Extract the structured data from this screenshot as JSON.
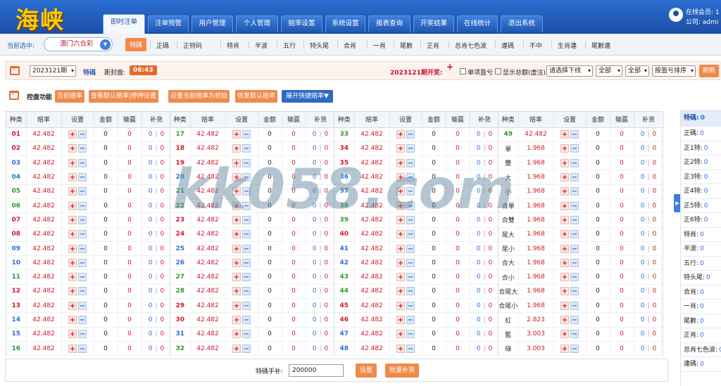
{
  "header": {
    "logo": "海峡",
    "tabs": [
      "即时注单",
      "注单预警",
      "用户管理",
      "个人管理",
      "赔率设置",
      "系统设置",
      "报表查询",
      "开奖结果",
      "在线统计",
      "退出系统"
    ],
    "active_tab": 0,
    "member_label": "在线会员: 1",
    "company_label": "公司: admi"
  },
  "subbar": {
    "current_label": "当前选中:",
    "lottery": "澳门六合彩",
    "tabs": [
      "特碼",
      "正碼",
      "正特码",
      "特肖",
      "半波",
      "五行",
      "特头尾",
      "合肖",
      "一肖",
      "尾數",
      "正肖",
      "总肖七色波",
      "連碼",
      "不中",
      "生肖連",
      "尾數連"
    ],
    "active_tab": 0
  },
  "info": {
    "period": "2023121期",
    "play": "特碼",
    "close_label": "距封盘:",
    "countdown": "06:43",
    "draw_label": "2023121期开奖:",
    "draw_value": "+",
    "cb_single": "单项盈亏",
    "cb_virtual": "显示总额(虚注)",
    "sel_1": "请选择下线",
    "sel_2": "全部",
    "sel_3": "全部",
    "sel_4": "按盈亏排序",
    "refresh": "刷新"
  },
  "controls": {
    "label": "控盘功能",
    "btn_current": "当前赔率",
    "btn_default": "查看默认赔率|停押设置",
    "btn_set_init": "设置当前赔率为初始",
    "btn_restore": "恢复默认赔率",
    "btn_expand": "展开快捷赔率▼"
  },
  "table": {
    "headers": [
      "种类",
      "赔率",
      "设置",
      "金额",
      "输赢",
      "补货"
    ],
    "cols": [
      [
        {
          "k": "01",
          "o": "42.482",
          "c": "red"
        },
        {
          "k": "02",
          "o": "42.482",
          "c": "red"
        },
        {
          "k": "03",
          "o": "42.482",
          "c": "blue"
        },
        {
          "k": "04",
          "o": "42.482",
          "c": "blue"
        },
        {
          "k": "05",
          "o": "42.482",
          "c": "green"
        },
        {
          "k": "06",
          "o": "42.482",
          "c": "green"
        },
        {
          "k": "07",
          "o": "42.482",
          "c": "red"
        },
        {
          "k": "08",
          "o": "42.482",
          "c": "red"
        },
        {
          "k": "09",
          "o": "42.482",
          "c": "blue"
        },
        {
          "k": "10",
          "o": "42.482",
          "c": "blue"
        },
        {
          "k": "11",
          "o": "42.482",
          "c": "green"
        },
        {
          "k": "12",
          "o": "42.482",
          "c": "red"
        },
        {
          "k": "13",
          "o": "42.482",
          "c": "red"
        },
        {
          "k": "14",
          "o": "42.482",
          "c": "blue"
        },
        {
          "k": "15",
          "o": "42.482",
          "c": "blue"
        },
        {
          "k": "16",
          "o": "42.482",
          "c": "green"
        }
      ],
      [
        {
          "k": "17",
          "o": "42.482",
          "c": "green"
        },
        {
          "k": "18",
          "o": "42.482",
          "c": "red"
        },
        {
          "k": "19",
          "o": "42.482",
          "c": "red"
        },
        {
          "k": "20",
          "o": "42.482",
          "c": "blue"
        },
        {
          "k": "21",
          "o": "42.482",
          "c": "green"
        },
        {
          "k": "22",
          "o": "42.482",
          "c": "green"
        },
        {
          "k": "23",
          "o": "42.482",
          "c": "red"
        },
        {
          "k": "24",
          "o": "42.482",
          "c": "red"
        },
        {
          "k": "25",
          "o": "42.482",
          "c": "blue"
        },
        {
          "k": "26",
          "o": "42.482",
          "c": "blue"
        },
        {
          "k": "27",
          "o": "42.482",
          "c": "green"
        },
        {
          "k": "28",
          "o": "42.482",
          "c": "green"
        },
        {
          "k": "29",
          "o": "42.482",
          "c": "red"
        },
        {
          "k": "30",
          "o": "42.482",
          "c": "red"
        },
        {
          "k": "31",
          "o": "42.482",
          "c": "blue"
        },
        {
          "k": "32",
          "o": "42.482",
          "c": "green"
        }
      ],
      [
        {
          "k": "33",
          "o": "42.482",
          "c": "green"
        },
        {
          "k": "34",
          "o": "42.482",
          "c": "red"
        },
        {
          "k": "35",
          "o": "42.482",
          "c": "red"
        },
        {
          "k": "36",
          "o": "42.482",
          "c": "blue"
        },
        {
          "k": "37",
          "o": "42.482",
          "c": "blue"
        },
        {
          "k": "38",
          "o": "42.482",
          "c": "green"
        },
        {
          "k": "39",
          "o": "42.482",
          "c": "green"
        },
        {
          "k": "40",
          "o": "42.482",
          "c": "red"
        },
        {
          "k": "41",
          "o": "42.482",
          "c": "blue"
        },
        {
          "k": "42",
          "o": "42.482",
          "c": "blue"
        },
        {
          "k": "43",
          "o": "42.482",
          "c": "green"
        },
        {
          "k": "44",
          "o": "42.482",
          "c": "green"
        },
        {
          "k": "45",
          "o": "42.482",
          "c": "red"
        },
        {
          "k": "46",
          "o": "42.482",
          "c": "red"
        },
        {
          "k": "47",
          "o": "42.482",
          "c": "blue"
        },
        {
          "k": "48",
          "o": "42.482",
          "c": "blue"
        }
      ],
      [
        {
          "k": "49",
          "o": "42.482",
          "c": "green"
        },
        {
          "k": "單",
          "o": "1.968",
          "c": "txt"
        },
        {
          "k": "雙",
          "o": "1.968",
          "c": "txt"
        },
        {
          "k": "大",
          "o": "1.968",
          "c": "txt"
        },
        {
          "k": "小",
          "o": "1.968",
          "c": "txt"
        },
        {
          "k": "合單",
          "o": "1.968",
          "c": "txt"
        },
        {
          "k": "合雙",
          "o": "1.968",
          "c": "txt"
        },
        {
          "k": "尾大",
          "o": "1.968",
          "c": "txt"
        },
        {
          "k": "尾小",
          "o": "1.968",
          "c": "txt"
        },
        {
          "k": "合大",
          "o": "1.968",
          "c": "txt"
        },
        {
          "k": "合小",
          "o": "1.968",
          "c": "txt"
        },
        {
          "k": "合尾大",
          "o": "1.968",
          "c": "txt"
        },
        {
          "k": "合尾小",
          "o": "1.968",
          "c": "txt"
        },
        {
          "k": "紅",
          "o": "2.823",
          "c": "txt"
        },
        {
          "k": "藍",
          "o": "3.003",
          "c": "txt"
        },
        {
          "k": "綠",
          "o": "3.003",
          "c": "txt"
        }
      ]
    ],
    "amount": "0",
    "winloss": "0",
    "bh_a": "0",
    "bh_sep": "|",
    "bh_b": "0",
    "plus": "+",
    "minus": "−"
  },
  "watermark": "kk058.com",
  "bottom": {
    "label": "特碼手补:",
    "value": "200000",
    "set": "设置",
    "batch": "批量补货"
  },
  "side": {
    "items": [
      {
        "label": "特碼:",
        "value": "0"
      },
      {
        "label": "正碼:",
        "value": "0"
      },
      {
        "label": "正1特:",
        "value": "0"
      },
      {
        "label": "正2特:",
        "value": "0"
      },
      {
        "label": "正3特:",
        "value": "0"
      },
      {
        "label": "正4特:",
        "value": "0"
      },
      {
        "label": "正5特:",
        "value": "0"
      },
      {
        "label": "正6特:",
        "value": "0"
      },
      {
        "label": "特肖:",
        "value": "0"
      },
      {
        "label": "半波:",
        "value": "0"
      },
      {
        "label": "五行:",
        "value": "0"
      },
      {
        "label": "特头尾:",
        "value": "0"
      },
      {
        "label": "合肖:",
        "value": "0"
      },
      {
        "label": "一肖:",
        "value": "0"
      },
      {
        "label": "尾數:",
        "value": "0"
      },
      {
        "label": "正肖:",
        "value": "0"
      },
      {
        "label": "总肖七色波:",
        "value": "0"
      },
      {
        "label": "連碼:",
        "value": "0"
      }
    ]
  }
}
